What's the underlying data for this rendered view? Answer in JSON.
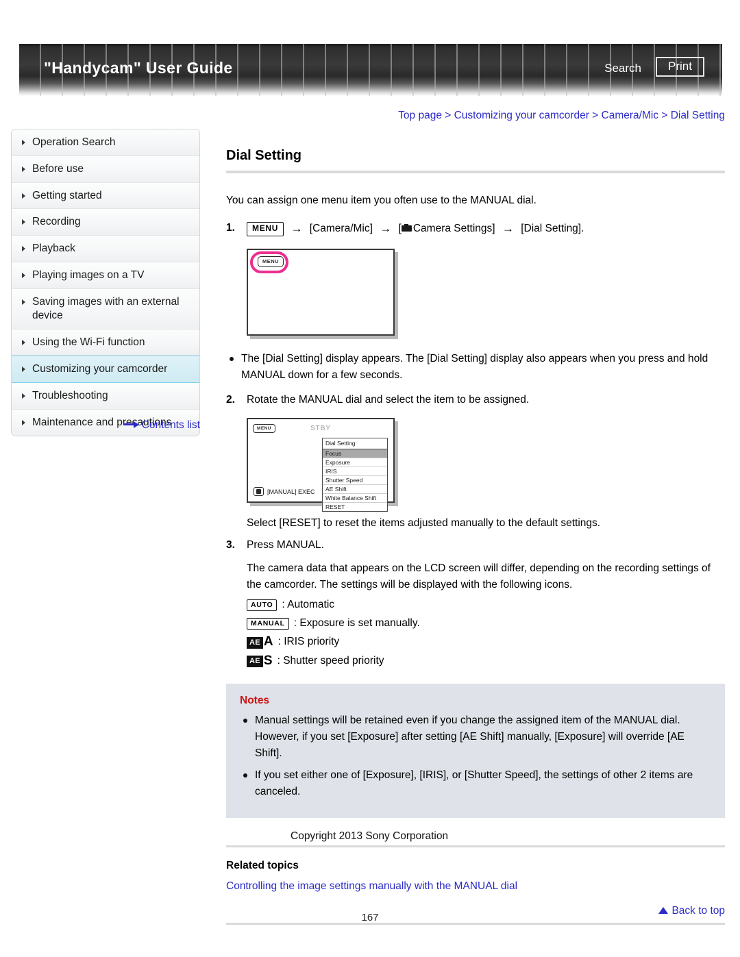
{
  "header": {
    "title": "\"Handycam\" User Guide",
    "search_label": "Search",
    "print_label": "Print"
  },
  "sidebar": {
    "items": [
      {
        "label": "Operation Search",
        "active": false
      },
      {
        "label": "Before use",
        "active": false
      },
      {
        "label": "Getting started",
        "active": false
      },
      {
        "label": "Recording",
        "active": false
      },
      {
        "label": "Playback",
        "active": false
      },
      {
        "label": "Playing images on a TV",
        "active": false
      },
      {
        "label": "Saving images with an external device",
        "active": false
      },
      {
        "label": "Using the Wi-Fi function",
        "active": false
      },
      {
        "label": "Customizing your camcorder",
        "active": true
      },
      {
        "label": "Troubleshooting",
        "active": false
      },
      {
        "label": "Maintenance and precautions",
        "active": false
      }
    ],
    "contents_link": "Contents list"
  },
  "breadcrumb": {
    "full": "Top page > Customizing your camcorder > Camera/Mic > Dial Setting",
    "items": [
      "Top page",
      "Customizing your camcorder",
      "Camera/Mic",
      "Dial Setting"
    ]
  },
  "main": {
    "title": "Dial Setting",
    "intro": "You can assign one menu item you often use to the MANUAL dial.",
    "step1": {
      "num": "1.",
      "menu_key": "MENU",
      "part_camera_mic": "[Camera/Mic]",
      "part_camera_settings": "Camera Settings]",
      "part_camera_settings_open": "[",
      "part_dial_setting": "[Dial Setting]."
    },
    "lcd1": {
      "menu_chip": "MENU"
    },
    "bullet1": "The [Dial Setting] display appears. The [Dial Setting] display also appears when you press and hold MANUAL down for a few seconds.",
    "step2": {
      "num": "2.",
      "text": "Rotate the MANUAL dial and select the item to be assigned."
    },
    "lcd2": {
      "menu_chip": "MENU",
      "status": "STBY",
      "list_header": "Dial Setting",
      "items": [
        {
          "label": "Focus",
          "selected": true
        },
        {
          "label": "Exposure",
          "selected": false
        },
        {
          "label": "IRIS",
          "selected": false
        },
        {
          "label": "Shutter Speed",
          "selected": false
        },
        {
          "label": "AE Shift",
          "selected": false
        },
        {
          "label": "White Balance Shift",
          "selected": false
        },
        {
          "label": "RESET",
          "selected": false
        }
      ],
      "footer_text": "[MANUAL] EXEC"
    },
    "after_lcd2": "Select [RESET] to reset the items adjusted manually to the default settings.",
    "step3": {
      "num": "3.",
      "text": "Press MANUAL.",
      "detail": "The camera data that appears on the LCD screen will differ, depending on the recording settings of the camcorder. The settings will be displayed with the following icons."
    },
    "legend": [
      {
        "badge": "AUTO",
        "type": "plain",
        "desc": ": Automatic"
      },
      {
        "badge": "MANUAL",
        "type": "plain",
        "desc": ": Exposure is set manually."
      },
      {
        "badge": "AE",
        "letter": "A",
        "type": "ae",
        "desc": ": IRIS priority"
      },
      {
        "badge": "AE",
        "letter": "S",
        "type": "ae",
        "desc": ": Shutter speed priority"
      }
    ],
    "notes": {
      "title": "Notes",
      "items": [
        "Manual settings will be retained even if you change the assigned item of the MANUAL dial. However, if you set [Exposure] after setting [AE Shift] manually, [Exposure] will override [AE Shift].",
        "If you set either one of [Exposure], [IRIS], or [Shutter Speed], the settings of other 2 items are canceled."
      ]
    },
    "related": {
      "title": "Related topics",
      "link": "Controlling the image settings manually with the MANUAL dial"
    },
    "back_to_top": "Back to top"
  },
  "footer": {
    "copyright": "Copyright 2013 Sony Corporation",
    "page_number": "167"
  },
  "colors": {
    "link": "#2b2bc8",
    "notes_title": "#cc1414",
    "notes_bg": "#dfe3e9",
    "highlight": "#dff2f8",
    "highlight_border": "#7fd3e8",
    "callout_circle": "#ec2f8f"
  }
}
